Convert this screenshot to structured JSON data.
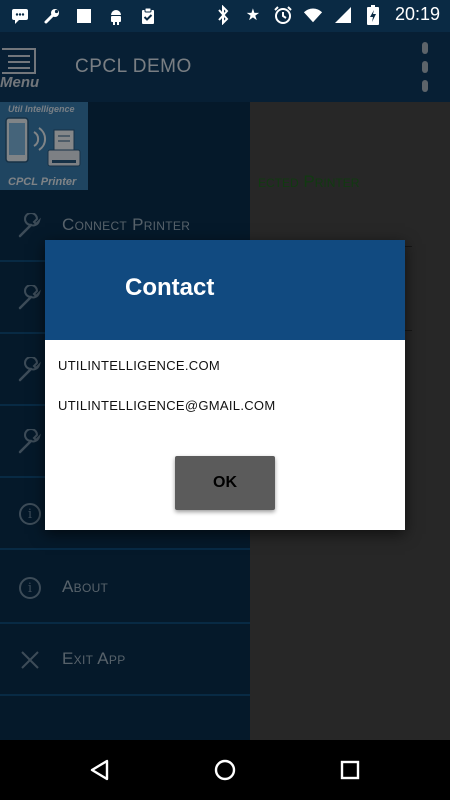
{
  "status_bar": {
    "time": "20:19",
    "left_icons": [
      "message-icon",
      "wrench-icon",
      "square-icon",
      "android-icon",
      "clipboard-check-icon"
    ],
    "right_icons": [
      "bluetooth-icon",
      "star-icon",
      "alarm-icon",
      "wifi-icon",
      "signal-icon",
      "battery-charging-icon"
    ]
  },
  "app_bar": {
    "menu_label": "Menu",
    "title": "CPCL DEMO"
  },
  "logo": {
    "top_text": "Util Intelligence",
    "bottom_text": "CPCL Printer"
  },
  "drawer": {
    "items": [
      {
        "label": "Connect Printer",
        "icon": "wrench-icon"
      },
      {
        "label": "",
        "icon": "wrench-icon"
      },
      {
        "label": "",
        "icon": "wrench-icon"
      },
      {
        "label": "",
        "icon": "wrench-icon"
      },
      {
        "label": "",
        "icon": "info-icon"
      },
      {
        "label": "About",
        "icon": "info-icon"
      },
      {
        "label": "Exit App",
        "icon": "close-icon"
      }
    ]
  },
  "main": {
    "status_text": "ected Printer"
  },
  "dialog": {
    "title": "Contact",
    "website": "UTILINTELLIGENCE.COM",
    "email": "UTILINTELLIGENCE@GMAIL.COM",
    "ok_label": "OK"
  },
  "colors": {
    "app_bar": "#0d3a60",
    "drawer": "#0a2e4e",
    "dialog_header": "#114a80",
    "status_text": "#1f6a1f"
  }
}
